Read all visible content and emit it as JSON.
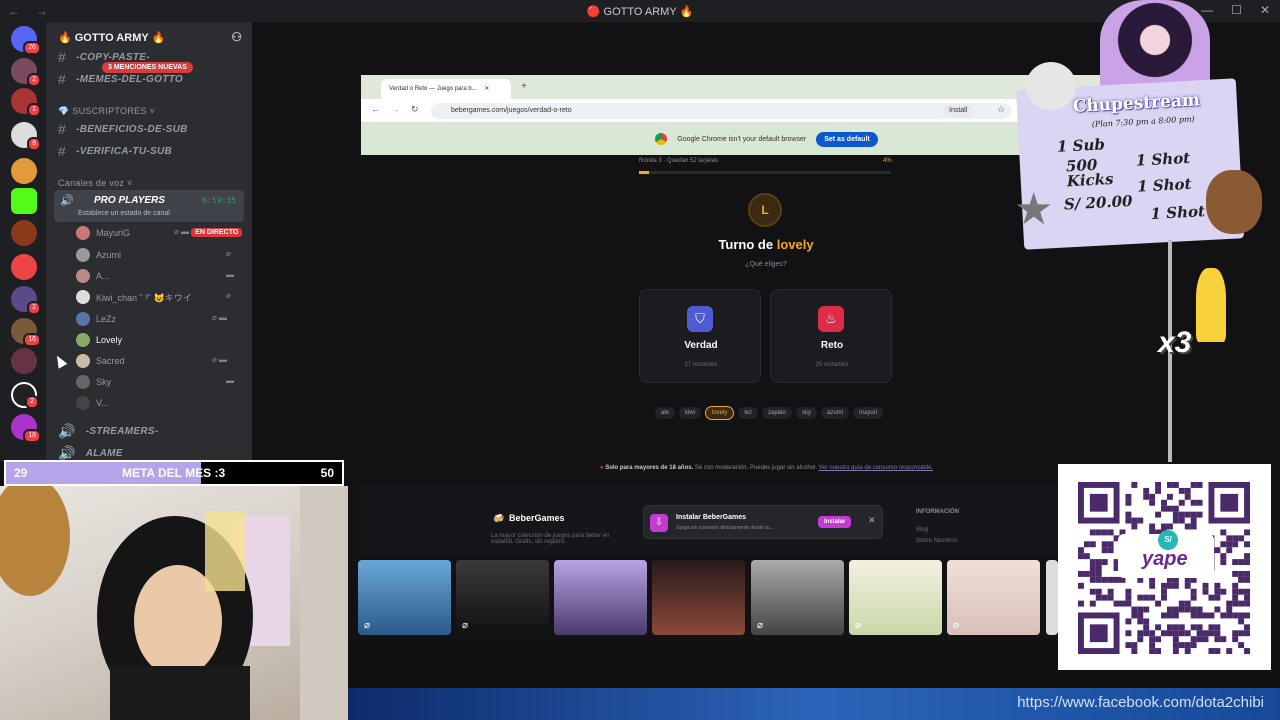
{
  "window": {
    "title": "🔴 GOTTO ARMY 🔥"
  },
  "servers": {
    "home_badge": "26",
    "badges": [
      "2",
      "1",
      "8",
      "2",
      "16",
      "2",
      "18"
    ]
  },
  "guild": {
    "name": "🔥 GOTTO ARMY 🔥",
    "mention_badge": "3 MENCIONES NUEVAS",
    "channels_top": [
      "-COPY-PASTE-",
      "-MEMES-DEL-GOTTO"
    ],
    "category_subs": "SUSCRIPTORES",
    "sub_channels": [
      "-BENEFICIOS-DE-SUB",
      "-VERIFICA-TU-SUB"
    ],
    "category_voice": "Canales de voz",
    "voice_channel": {
      "name": "PRO PLAYERS",
      "timer": "6:59:35",
      "status": "Establece un estado de canal"
    },
    "live_tag": "EN DIRECTO",
    "voice_users": [
      "MayuriG",
      "Azumi",
      "A...",
      "Kiwi_chan ˘ ³˘ 😺キウイ",
      "LeZz",
      "Lovely",
      "Sacred",
      "Sky",
      "V..."
    ],
    "other_channels": [
      "-STREAMERS-",
      "ALAME"
    ]
  },
  "goal": {
    "current": "29",
    "label": "META DEL MES :3",
    "target": "50",
    "progress": 0.58
  },
  "browser": {
    "tab_title": "Verdad o Reto — Juego para b...",
    "url": "bebergames.com/juegos/verdad-o-reto",
    "install": "Install",
    "default_msg": "Google Chrome isn't your default browser",
    "default_btn": "Set as default",
    "progress_text": "Ronda 3 · Quedan 52 tarjetas",
    "progress_pct": "4%",
    "avatar_letter": "L",
    "turn_prefix": "Turno de",
    "turn_name": "lovely",
    "question": "¿Qué eliges?",
    "truth": {
      "label": "Verdad",
      "remaining": "27 restantes"
    },
    "dare": {
      "label": "Reto",
      "remaining": "25 restantes"
    },
    "players": [
      "ale",
      "kiwi",
      "lovely",
      "lez",
      "zapato",
      "sky",
      "azumi",
      "mayuri"
    ],
    "active_player": "lovely",
    "warning_bold": "Solo para mayores de 18 años.",
    "warning_rest": "Sé con moderación. Puedes jugar sin alcohol.",
    "warning_link": "Ver nuestra guía de consumo responsable.",
    "footer_brand": "BeberGames",
    "footer_desc": "La mayor colección de juegos para beber en español. Gratis, sin registro.",
    "footer_info": "INFORMACIÓN",
    "footer_links": [
      "Blog",
      "Sobre Nosotros"
    ],
    "toast": {
      "title": "Instalar BeberGames",
      "sub": "Juega sin conexión directamente desde tu...",
      "btn": "Instalar"
    }
  },
  "overlay": {
    "title": "Chupestream",
    "schedule": "(Plan 7:30 pm a 8:00 pm)",
    "lines": [
      "1 Sub",
      "1 Shot",
      "500 Kicks",
      "1 Shot",
      "S/ 20.00",
      "1 Shot"
    ],
    "multiplier": "x3",
    "pay_brand": "yape",
    "pay_symbol": "S/"
  },
  "stream_footer": {
    "url": "https://www.facebook.com/dota2chibi"
  }
}
